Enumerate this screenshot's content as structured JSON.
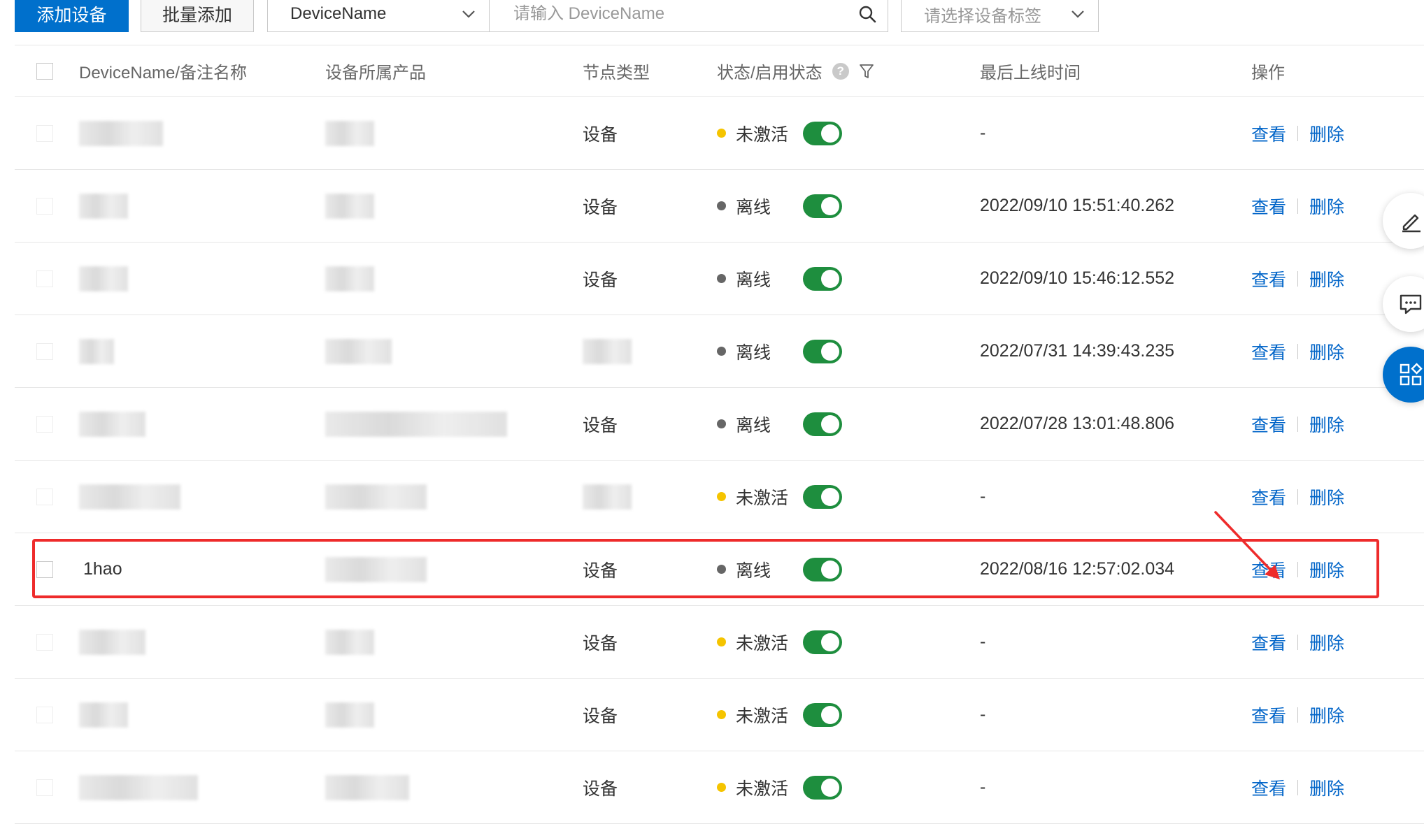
{
  "toolbar": {
    "add_device_label": "添加设备",
    "batch_add_label": "批量添加",
    "search_type_value": "DeviceName",
    "search_placeholder": "请输入 DeviceName",
    "tag_select_placeholder": "请选择设备标签"
  },
  "table": {
    "columns": {
      "name": "DeviceName/备注名称",
      "product": "设备所属产品",
      "node_type": "节点类型",
      "status": "状态/启用状态",
      "last_online": "最后上线时间",
      "operations": "操作"
    },
    "rows": [
      {
        "name": "",
        "node_type": "设备",
        "status": "未激活",
        "status_color": "#f5c400",
        "enabled": true,
        "last_online": "-",
        "view": "查看",
        "delete": "删除"
      },
      {
        "name": "",
        "node_type": "设备",
        "status": "离线",
        "status_color": "#666666",
        "enabled": true,
        "last_online": "2022/09/10 15:51:40.262",
        "view": "查看",
        "delete": "删除"
      },
      {
        "name": "",
        "node_type": "设备",
        "status": "离线",
        "status_color": "#666666",
        "enabled": true,
        "last_online": "2022/09/10 15:46:12.552",
        "view": "查看",
        "delete": "删除"
      },
      {
        "name": "",
        "node_type": "",
        "status": "离线",
        "status_color": "#666666",
        "enabled": true,
        "last_online": "2022/07/31 14:39:43.235",
        "view": "查看",
        "delete": "删除"
      },
      {
        "name": "",
        "node_type": "设备",
        "status": "离线",
        "status_color": "#666666",
        "enabled": true,
        "last_online": "2022/07/28 13:01:48.806",
        "view": "查看",
        "delete": "删除"
      },
      {
        "name": "",
        "node_type": "",
        "status": "未激活",
        "status_color": "#f5c400",
        "enabled": true,
        "last_online": "-",
        "view": "查看",
        "delete": "删除"
      },
      {
        "name": "1hao",
        "node_type": "设备",
        "status": "离线",
        "status_color": "#666666",
        "enabled": true,
        "last_online": "2022/08/16 12:57:02.034",
        "view": "查看",
        "delete": "删除",
        "highlighted": true
      },
      {
        "name": "",
        "node_type": "设备",
        "status": "未激活",
        "status_color": "#f5c400",
        "enabled": true,
        "last_online": "-",
        "view": "查看",
        "delete": "删除"
      },
      {
        "name": "",
        "node_type": "设备",
        "status": "未激活",
        "status_color": "#f5c400",
        "enabled": true,
        "last_online": "-",
        "view": "查看",
        "delete": "删除"
      },
      {
        "name": "",
        "node_type": "设备",
        "status": "未激活",
        "status_color": "#f5c400",
        "enabled": true,
        "last_online": "-",
        "view": "查看",
        "delete": "删除"
      }
    ]
  },
  "colors": {
    "primary": "#0070cc",
    "link": "#0064c8",
    "toggle_on": "#1e8e3e",
    "highlight": "#ee2b2b"
  },
  "icons": {
    "search": "search-icon",
    "chevron": "chevron-down-icon",
    "help": "help-icon",
    "filter": "filter-icon",
    "edit": "edit-icon",
    "chat": "chat-icon",
    "apps": "apps-icon"
  }
}
